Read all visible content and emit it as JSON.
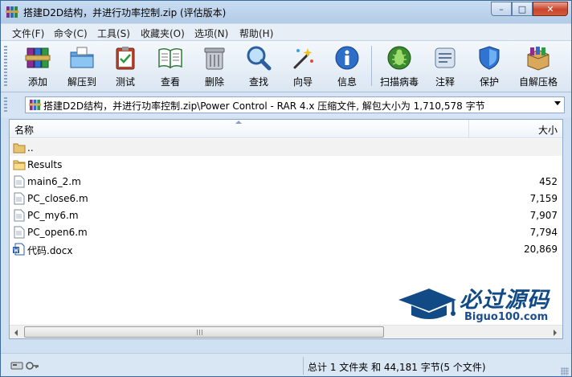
{
  "window": {
    "title": "搭建D2D结构，并进行功率控制.zip (评估版本)",
    "controls": {
      "minimize": "–",
      "maximize": "□",
      "close": "✕"
    }
  },
  "menu": [
    {
      "label": "文件(F)"
    },
    {
      "label": "命令(C)"
    },
    {
      "label": "工具(S)"
    },
    {
      "label": "收藏夹(O)"
    },
    {
      "label": "选项(N)"
    },
    {
      "label": "帮助(H)"
    }
  ],
  "toolbar": [
    {
      "label": "添加",
      "icon": "add-books-icon"
    },
    {
      "label": "解压到",
      "icon": "extract-folder-icon"
    },
    {
      "label": "测试",
      "icon": "test-clipboard-icon"
    },
    {
      "label": "查看",
      "icon": "view-book-icon"
    },
    {
      "label": "删除",
      "icon": "trash-icon"
    },
    {
      "label": "查找",
      "icon": "magnifier-icon"
    },
    {
      "label": "向导",
      "icon": "wizard-wand-icon"
    },
    {
      "label": "信息",
      "icon": "info-icon"
    },
    {
      "label": "扫描病毒",
      "icon": "virus-bug-icon"
    },
    {
      "label": "注释",
      "icon": "comment-icon"
    },
    {
      "label": "保护",
      "icon": "shield-icon"
    },
    {
      "label": "自解压格",
      "icon": "sfx-box-icon"
    }
  ],
  "address": {
    "path": "搭建D2D结构，并进行功率控制.zip\\Power Control - RAR 4.x 压缩文件, 解包大小为 1,710,578 字节"
  },
  "list": {
    "columns": {
      "name": "名称",
      "size": "大小"
    },
    "rows": [
      {
        "name": "..",
        "size": "",
        "type": "up"
      },
      {
        "name": "Results",
        "size": "",
        "type": "folder"
      },
      {
        "name": "main6_2.m",
        "size": "452",
        "type": "file"
      },
      {
        "name": "PC_close6.m",
        "size": "7,159",
        "type": "file"
      },
      {
        "name": "PC_my6.m",
        "size": "7,907",
        "type": "file"
      },
      {
        "name": "PC_open6.m",
        "size": "7,794",
        "type": "file"
      },
      {
        "name": "代码.docx",
        "size": "20,869",
        "type": "docx"
      }
    ]
  },
  "watermark": {
    "text": "必过源码",
    "url": "Biguo100.com"
  },
  "status": {
    "text": "总计 1 文件夹 和 44,181 字节(5 个文件)"
  }
}
